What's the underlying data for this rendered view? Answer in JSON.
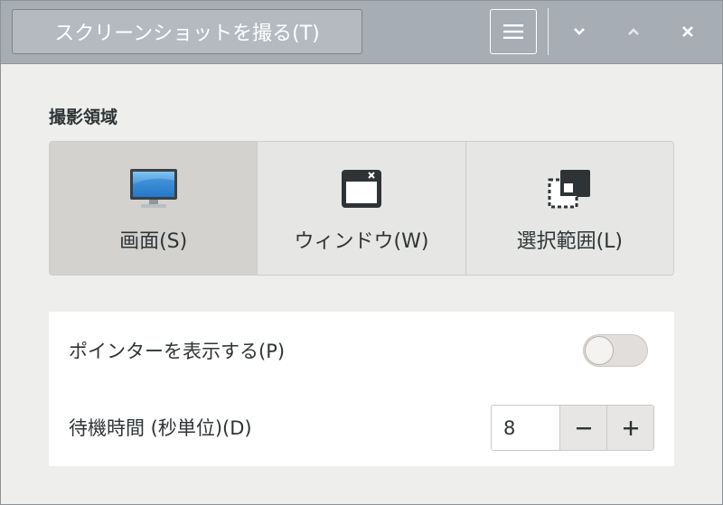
{
  "header": {
    "take_label": "スクリーンショットを撮る(T)",
    "menu_icon": "hamburger-menu-icon",
    "minimize_icon": "chevron-down-icon",
    "maximize_icon": "chevron-up-icon",
    "close_icon": "close-icon",
    "bar_color": "#a6adb4"
  },
  "area": {
    "title": "撮影領域",
    "options": [
      {
        "label": "画面(S)",
        "icon": "monitor-icon",
        "selected": true
      },
      {
        "label": "ウィンドウ(W)",
        "icon": "window-icon",
        "selected": false
      },
      {
        "label": "選択範囲(L)",
        "icon": "selection-icon",
        "selected": false
      }
    ]
  },
  "options": {
    "pointer": {
      "label": "ポインターを表示する(P)",
      "on": false
    },
    "delay": {
      "label": "待機時間 (秒単位)(D)",
      "value": "8",
      "minus": "−",
      "plus": "+"
    }
  }
}
